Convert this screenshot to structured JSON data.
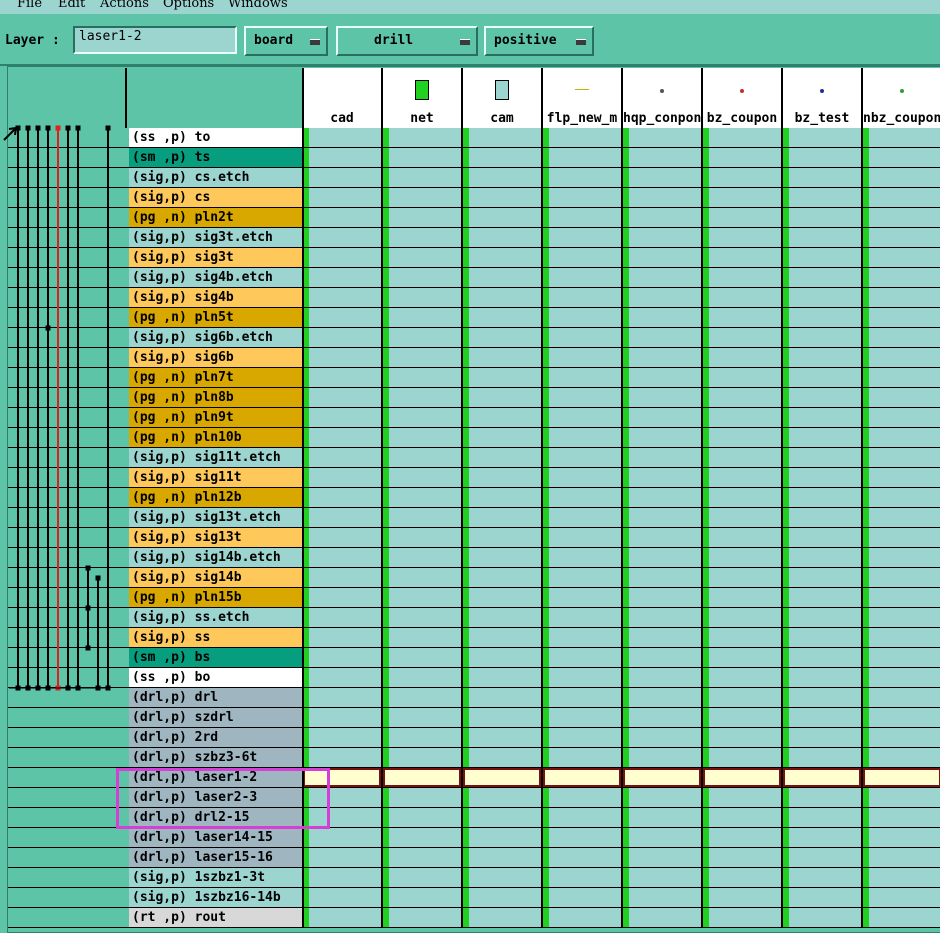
{
  "menu": [
    "File",
    "Edit",
    "Actions",
    "Options",
    "Windows"
  ],
  "toolbar": {
    "layer_label": "Layer :",
    "layer_value": "laser1-2",
    "context": "board",
    "type": "drill",
    "polarity": "positive"
  },
  "columns": [
    {
      "name": "cad",
      "icon": "none"
    },
    {
      "name": "net",
      "icon": "green-square-icon"
    },
    {
      "name": "cam",
      "icon": "cyan-square-icon"
    },
    {
      "name": "flp_new_m",
      "icon": "yellow-line-icon"
    },
    {
      "name": "hqp_conpon",
      "icon": "dot-icon"
    },
    {
      "name": "bz_coupon",
      "icon": "red-dot-icon"
    },
    {
      "name": "bz_test",
      "icon": "blue-dot-icon"
    },
    {
      "name": "nbz_coupon",
      "icon": "green-dot-icon"
    }
  ],
  "rows": [
    {
      "type": "(ss ,p)",
      "name": "to",
      "kind": "ss"
    },
    {
      "type": "(sm ,p)",
      "name": "ts",
      "kind": "sm"
    },
    {
      "type": "(sig,p)",
      "name": "cs.etch",
      "kind": "etch"
    },
    {
      "type": "(sig,p)",
      "name": "cs",
      "kind": "sig"
    },
    {
      "type": "(pg ,n)",
      "name": "pln2t",
      "kind": "pg"
    },
    {
      "type": "(sig,p)",
      "name": "sig3t.etch",
      "kind": "etch"
    },
    {
      "type": "(sig,p)",
      "name": "sig3t",
      "kind": "sig"
    },
    {
      "type": "(sig,p)",
      "name": "sig4b.etch",
      "kind": "etch"
    },
    {
      "type": "(sig,p)",
      "name": "sig4b",
      "kind": "sig"
    },
    {
      "type": "(pg ,n)",
      "name": "pln5t",
      "kind": "pg"
    },
    {
      "type": "(sig,p)",
      "name": "sig6b.etch",
      "kind": "etch"
    },
    {
      "type": "(sig,p)",
      "name": "sig6b",
      "kind": "sig"
    },
    {
      "type": "(pg ,n)",
      "name": "pln7t",
      "kind": "pg"
    },
    {
      "type": "(pg ,n)",
      "name": "pln8b",
      "kind": "pg"
    },
    {
      "type": "(pg ,n)",
      "name": "pln9t",
      "kind": "pg"
    },
    {
      "type": "(pg ,n)",
      "name": "pln10b",
      "kind": "pg"
    },
    {
      "type": "(sig,p)",
      "name": "sig11t.etch",
      "kind": "etch"
    },
    {
      "type": "(sig,p)",
      "name": "sig11t",
      "kind": "sig"
    },
    {
      "type": "(pg ,n)",
      "name": "pln12b",
      "kind": "pg"
    },
    {
      "type": "(sig,p)",
      "name": "sig13t.etch",
      "kind": "etch"
    },
    {
      "type": "(sig,p)",
      "name": "sig13t",
      "kind": "sig"
    },
    {
      "type": "(sig,p)",
      "name": "sig14b.etch",
      "kind": "etch"
    },
    {
      "type": "(sig,p)",
      "name": "sig14b",
      "kind": "sig"
    },
    {
      "type": "(pg ,n)",
      "name": "pln15b",
      "kind": "pg"
    },
    {
      "type": "(sig,p)",
      "name": "ss.etch",
      "kind": "etch"
    },
    {
      "type": "(sig,p)",
      "name": "ss",
      "kind": "sig"
    },
    {
      "type": "(sm ,p)",
      "name": "bs",
      "kind": "sm"
    },
    {
      "type": "(ss ,p)",
      "name": "bo",
      "kind": "ss"
    },
    {
      "type": "(drl,p)",
      "name": "drl",
      "kind": "drl"
    },
    {
      "type": "(drl,p)",
      "name": "szdrl",
      "kind": "drl"
    },
    {
      "type": "(drl,p)",
      "name": "2rd",
      "kind": "drl"
    },
    {
      "type": "(drl,p)",
      "name": "szbz3-6t",
      "kind": "drl"
    },
    {
      "type": "(drl,p)",
      "name": "laser1-2",
      "kind": "drl",
      "selected": true
    },
    {
      "type": "(drl,p)",
      "name": "laser2-3",
      "kind": "drl"
    },
    {
      "type": "(drl,p)",
      "name": "drl2-15",
      "kind": "drl"
    },
    {
      "type": "(drl,p)",
      "name": "laser14-15",
      "kind": "drl"
    },
    {
      "type": "(drl,p)",
      "name": "laser15-16",
      "kind": "drl"
    },
    {
      "type": "(sig,p)",
      "name": "1szbz1-3t",
      "kind": "etch"
    },
    {
      "type": "(sig,p)",
      "name": "1szbz16-14b",
      "kind": "etch"
    },
    {
      "type": "(rt ,p)",
      "name": "rout",
      "kind": "rt"
    }
  ],
  "colors": {
    "ss": "#ffffff",
    "sm": "#069e7e",
    "etch": "#9cd4d0",
    "sig": "#ffc85a",
    "pg": "#d9a800",
    "drl": "#9fb5bf",
    "rt": "#d8d8d8",
    "selected_cell": "#ffffd0",
    "marker": "#22d022",
    "highlight": "#d63fd6"
  }
}
